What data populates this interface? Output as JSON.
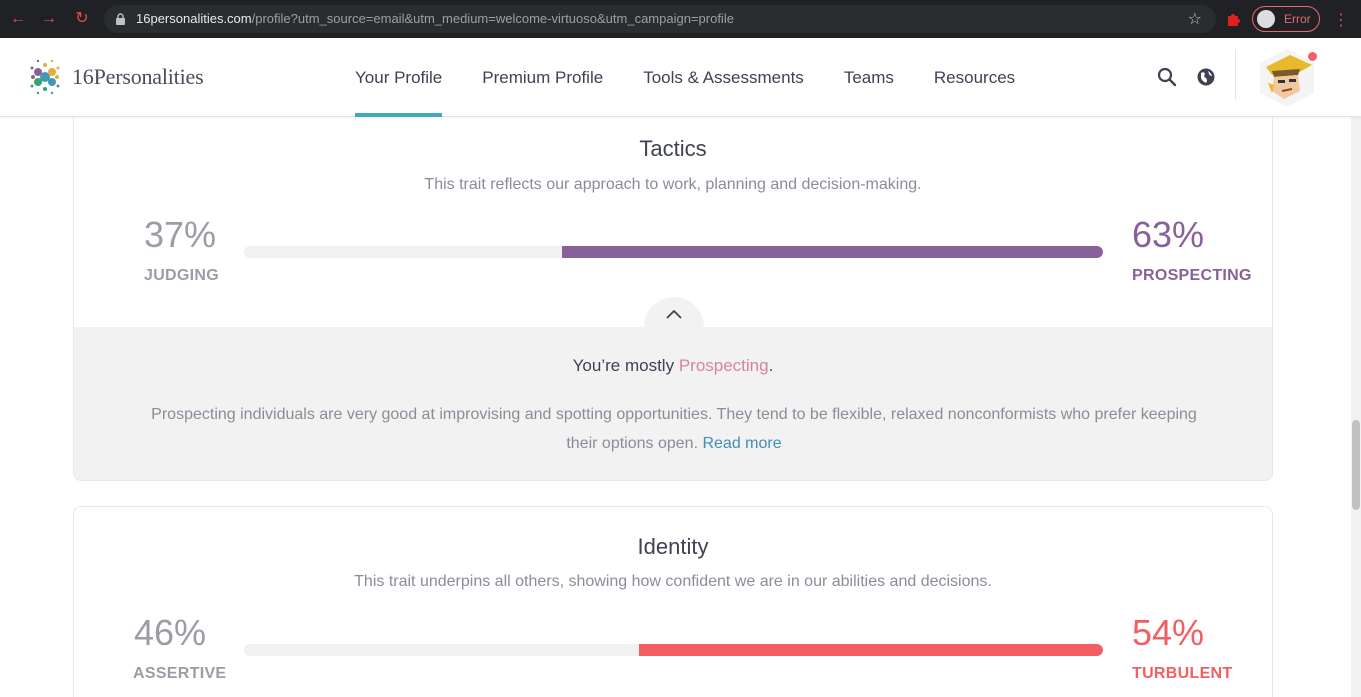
{
  "browser": {
    "url_host": "16personalities.com",
    "url_path": "/profile?utm_source=email&utm_medium=welcome-virtuoso&utm_campaign=profile",
    "profile_status": "Error"
  },
  "header": {
    "brand": "16Personalities",
    "nav": {
      "your_profile": "Your Profile",
      "premium_profile": "Premium Profile",
      "tools": "Tools & Assessments",
      "teams": "Teams",
      "resources": "Resources"
    },
    "active_nav": "Your Profile"
  },
  "tactics": {
    "title": "Tactics",
    "description": "This trait reflects our approach to work, planning and decision-making.",
    "left_pct": "37%",
    "left_label": "JUDGING",
    "right_pct": "63%",
    "right_label": "PROSPECTING",
    "right_value": 63,
    "color": "#88619a",
    "mostly_prefix": "You’re mostly ",
    "mostly_trait": "Prospecting",
    "mostly_suffix": ".",
    "explanation": "Prospecting individuals are very good at improvising and spotting opportunities. They tend to be flexible, relaxed nonconformists who prefer keeping their options open.",
    "read_more": "Read more"
  },
  "identity": {
    "title": "Identity",
    "description": "This trait underpins all others, showing how confident we are in our abilities and decisions.",
    "left_pct": "46%",
    "left_label": "ASSERTIVE",
    "right_pct": "54%",
    "right_label": "TURBULENT",
    "right_value": 54,
    "color": "#f25e62"
  },
  "colors": {
    "muted": "#9b9ca6",
    "accent_nav": "#3fa9c0",
    "link": "#3f8fb5"
  }
}
